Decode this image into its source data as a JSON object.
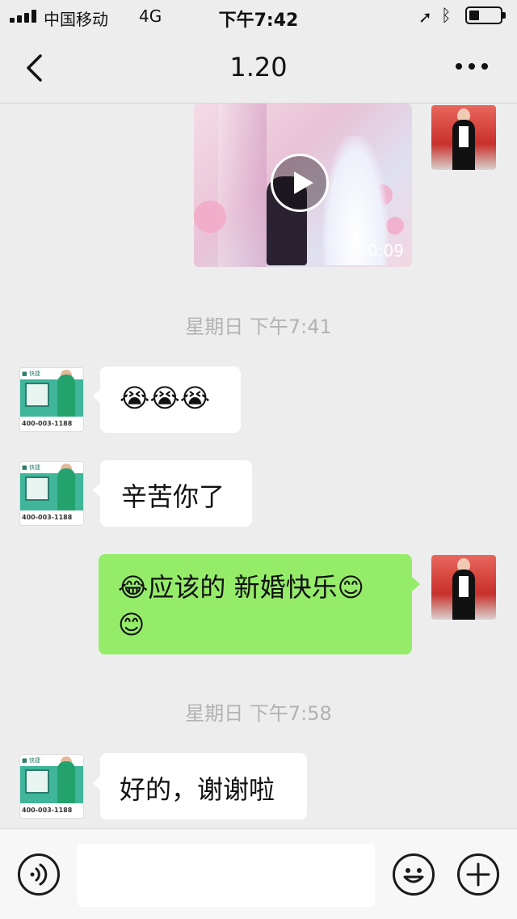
{
  "status_bar": {
    "carrier": "中国移动",
    "network": "4G",
    "time": "下午7:42"
  },
  "header": {
    "title": "1.20"
  },
  "messages": {
    "video": {
      "duration": "0:09"
    },
    "timestamp1": "星期日 下午7:41",
    "msg1": "😭😭😭",
    "msg2": "辛苦你了",
    "msg3_line1": "😂应该的 新婚快乐😊",
    "msg3_line2": "😊",
    "timestamp2": "星期日 下午7:58",
    "msg4": "好的，谢谢啦"
  },
  "contact_avatar": {
    "phone": "400-003-1188"
  },
  "colors": {
    "background": "#ededed",
    "bubble_sent": "#95ec69",
    "bubble_received": "#ffffff",
    "timestamp_text": "#b2b2b2"
  },
  "icons": {
    "back": "chevron-left-icon",
    "more": "more-dots-icon",
    "voice": "voice-icon",
    "emoji": "emoji-icon",
    "add": "plus-icon"
  }
}
